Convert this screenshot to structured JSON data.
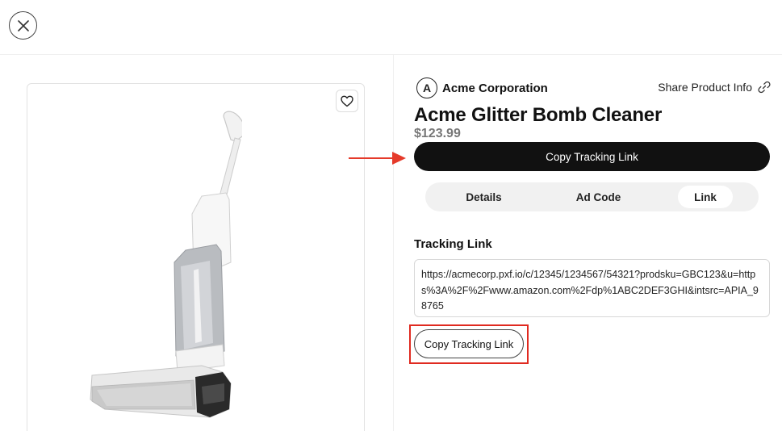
{
  "header": {
    "close_icon": "close-icon"
  },
  "product": {
    "brand_initial": "A",
    "brand_name": "Acme Corporation",
    "title": "Acme Glitter Bomb Cleaner",
    "price": "$123.99",
    "favorite_icon": "heart-icon",
    "image": "cordless-wet-dry-vacuum"
  },
  "share": {
    "label": "Share Product Info",
    "icon": "link-icon"
  },
  "actions": {
    "primary_copy_label": "Copy Tracking Link",
    "secondary_copy_label": "Copy Tracking Link"
  },
  "tabs": [
    {
      "label": "Details",
      "active": false
    },
    {
      "label": "Ad Code",
      "active": false
    },
    {
      "label": "Link",
      "active": true
    }
  ],
  "tracking": {
    "section_label": "Tracking Link",
    "url": "https://acmecorp.pxf.io/c/12345/1234567/54321?prodsku=GBC123&u=https%3A%2F%2Fwww.amazon.com%2Fdp%1ABC2DEF3GHI&intsrc=APIA_98765"
  },
  "annotations": {
    "arrow_color": "#e53a2a",
    "highlight_color": "#e02a20"
  },
  "colors": {
    "primary_button": "#111111",
    "tab_background": "#f1f1f1",
    "price": "#777777"
  }
}
